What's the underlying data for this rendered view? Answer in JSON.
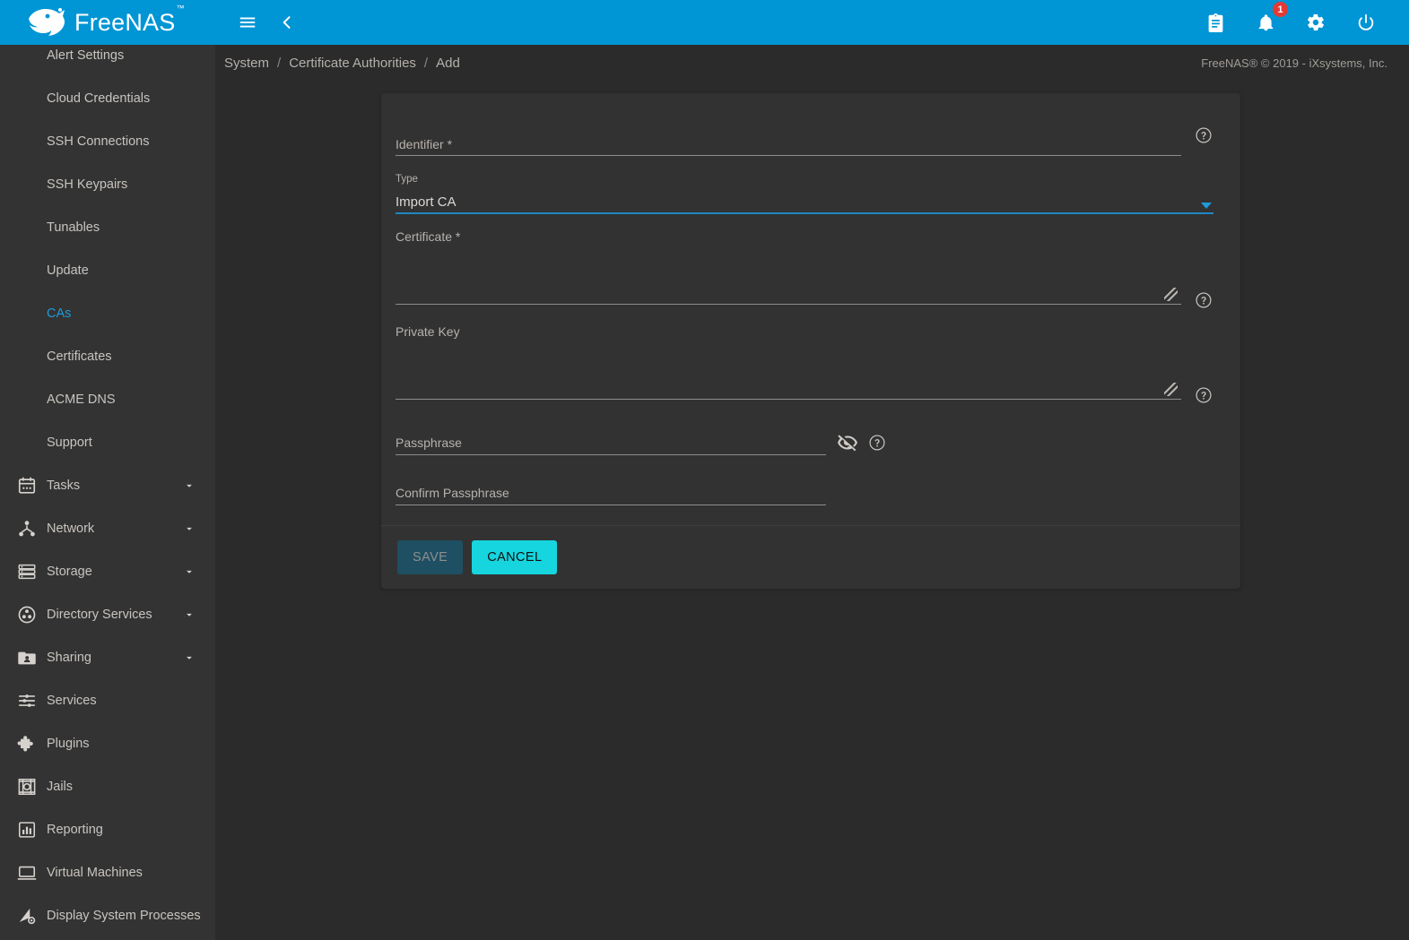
{
  "brand": {
    "name": "FreeNAS",
    "trademark": "™"
  },
  "topbar": {
    "menu_icon": "hamburger-menu-icon",
    "back_icon": "chevron-left-icon",
    "tasks_icon": "clipboard-icon",
    "alerts_icon": "bell-icon",
    "alerts_count": "1",
    "settings_icon": "gear-icon",
    "power_icon": "power-icon",
    "accent": "#0095d5"
  },
  "sidebar": {
    "items": [
      {
        "label": "Alert Settings",
        "icon": null,
        "sub": true,
        "expandable": false,
        "active": false
      },
      {
        "label": "Cloud Credentials",
        "icon": null,
        "sub": true,
        "expandable": false,
        "active": false
      },
      {
        "label": "SSH Connections",
        "icon": null,
        "sub": true,
        "expandable": false,
        "active": false
      },
      {
        "label": "SSH Keypairs",
        "icon": null,
        "sub": true,
        "expandable": false,
        "active": false
      },
      {
        "label": "Tunables",
        "icon": null,
        "sub": true,
        "expandable": false,
        "active": false
      },
      {
        "label": "Update",
        "icon": null,
        "sub": true,
        "expandable": false,
        "active": false
      },
      {
        "label": "CAs",
        "icon": null,
        "sub": true,
        "expandable": false,
        "active": true
      },
      {
        "label": "Certificates",
        "icon": null,
        "sub": true,
        "expandable": false,
        "active": false
      },
      {
        "label": "ACME DNS",
        "icon": null,
        "sub": true,
        "expandable": false,
        "active": false
      },
      {
        "label": "Support",
        "icon": null,
        "sub": true,
        "expandable": false,
        "active": false
      },
      {
        "label": "Tasks",
        "icon": "calendar-icon",
        "sub": false,
        "expandable": true,
        "active": false
      },
      {
        "label": "Network",
        "icon": "network-icon",
        "sub": false,
        "expandable": true,
        "active": false
      },
      {
        "label": "Storage",
        "icon": "storage-icon",
        "sub": false,
        "expandable": true,
        "active": false
      },
      {
        "label": "Directory Services",
        "icon": "directory-services-icon",
        "sub": false,
        "expandable": true,
        "active": false
      },
      {
        "label": "Sharing",
        "icon": "sharing-icon",
        "sub": false,
        "expandable": true,
        "active": false
      },
      {
        "label": "Services",
        "icon": "services-icon",
        "sub": false,
        "expandable": false,
        "active": false
      },
      {
        "label": "Plugins",
        "icon": "plugins-icon",
        "sub": false,
        "expandable": false,
        "active": false
      },
      {
        "label": "Jails",
        "icon": "jails-icon",
        "sub": false,
        "expandable": false,
        "active": false
      },
      {
        "label": "Reporting",
        "icon": "reporting-icon",
        "sub": false,
        "expandable": false,
        "active": false
      },
      {
        "label": "Virtual Machines",
        "icon": "virtual-machines-icon",
        "sub": false,
        "expandable": false,
        "active": false
      },
      {
        "label": "Display System Processes",
        "icon": "display-system-processes-icon",
        "sub": false,
        "expandable": false,
        "active": false
      }
    ],
    "active_color": "#1e9bdb"
  },
  "breadcrumb": {
    "items": [
      "System",
      "Certificate Authorities",
      "Add"
    ],
    "separator": "/"
  },
  "copyright": "FreeNAS® © 2019 - iXsystems, Inc.",
  "form": {
    "identifier": {
      "label": "Identifier *",
      "value": "",
      "placeholder": "Identifier *",
      "help_icon": "help-circle-icon"
    },
    "type": {
      "label": "Type",
      "value": "Import CA",
      "arrow_icon": "chevron-down-icon",
      "focus_color": "#1e87c4"
    },
    "certificate": {
      "label": "Certificate *",
      "value": "",
      "help_icon": "help-circle-icon",
      "resize_handle": "resize-handle-icon"
    },
    "private_key": {
      "label": "Private Key",
      "value": "",
      "help_icon": "help-circle-icon",
      "resize_handle": "resize-handle-icon"
    },
    "passphrase": {
      "label": "Passphrase",
      "value": "",
      "placeholder": "Passphrase",
      "visibility_icon": "eye-off-icon",
      "help_icon": "help-circle-icon"
    },
    "confirm_passphrase": {
      "label": "Confirm Passphrase",
      "value": "",
      "placeholder": "Confirm Passphrase"
    },
    "actions": {
      "save_label": "SAVE",
      "save_disabled": true,
      "cancel_label": "CANCEL",
      "cancel_color": "#16d5de"
    }
  }
}
